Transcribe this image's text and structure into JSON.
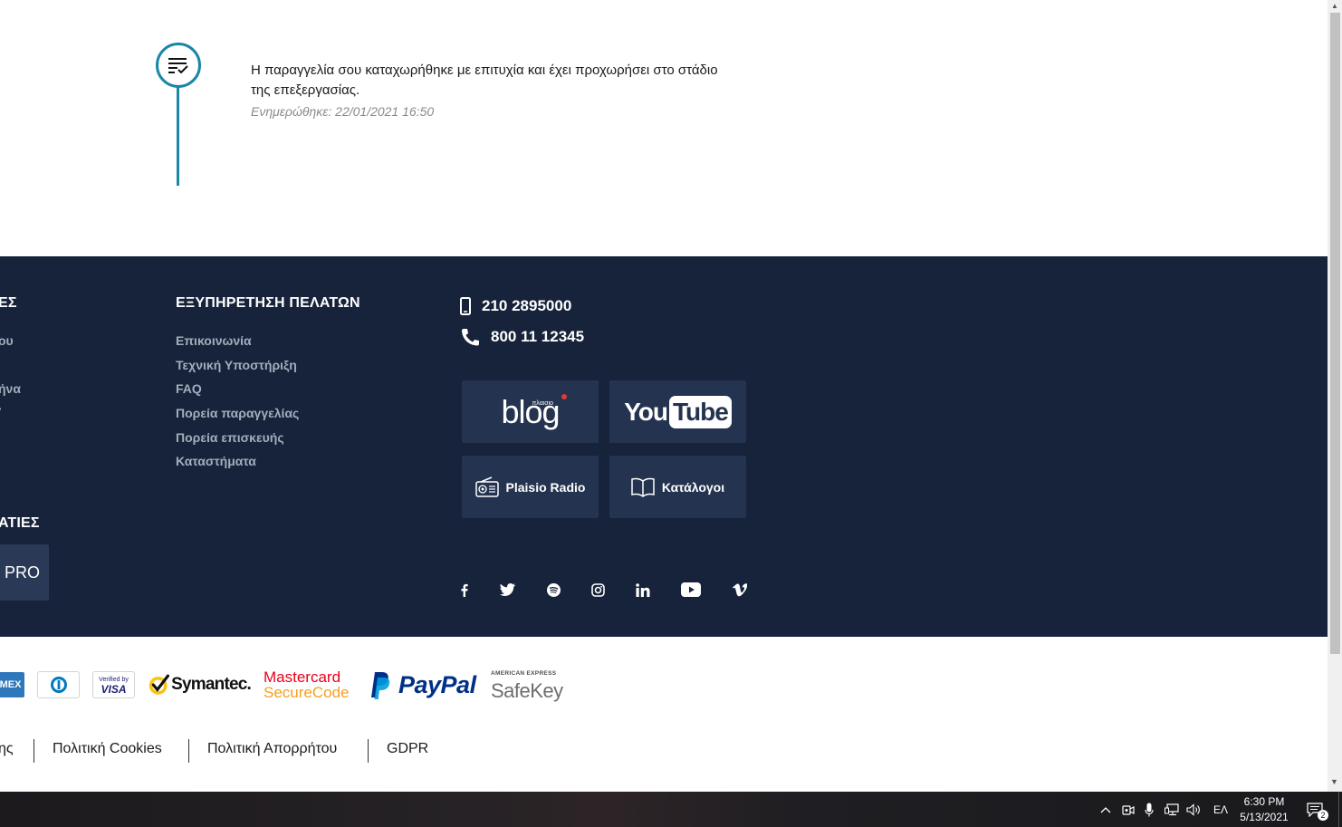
{
  "timeline": {
    "status_icon": "order-list-check-icon",
    "message": "Η παραγγελία σου καταχωρήθηκε με επιτυχία και έχει προχωρήσει στο στάδιο της επεξεργασίας.",
    "updated": "Ενημερώθηκε: 22/01/2021 16:50"
  },
  "footer": {
    "col1_head_partial": "ΕΣ",
    "col1_links_partial": [
      "ου",
      "ήνα",
      "·"
    ],
    "partnerships_head_partial": "ΑΤΙΕΣ",
    "pro_button": "PRO",
    "customer_service": {
      "heading": "ΕΞΥΠΗΡΕΤΗΣΗ ΠΕΛΑΤΩΝ",
      "links": [
        "Επικοινωνία",
        "Τεχνική Υποστήριξη",
        "FAQ",
        "Πορεία παραγγελίας",
        "Πορεία επισκευής",
        "Καταστήματα"
      ]
    },
    "phones": {
      "mobile": "210 2895000",
      "landline": "800 11 12345"
    },
    "tiles": {
      "blog_small": "πλαισιο",
      "blog": "blog",
      "youtube_you": "You",
      "youtube_tube": "Tube",
      "radio": "Plaisio Radio",
      "catalogs": "Κατάλογοι"
    },
    "social_icons": [
      "facebook-icon",
      "twitter-icon",
      "spotify-icon",
      "instagram-icon",
      "linkedin-icon",
      "youtube-icon",
      "vimeo-icon"
    ]
  },
  "payments": {
    "amex_partial": "MEX",
    "verified_line1": "Verified by",
    "verified_line2": "VISA",
    "symantec": "Symantec.",
    "mastercard_line1": "Mastercard",
    "mastercard_line2": "SecureCode",
    "paypal": "PayPal",
    "safekey_line1": "AMERICAN EXPRESS",
    "safekey_line2": "SafeKey"
  },
  "legal_links": {
    "partial": "ης",
    "cookies": "Πολιτική Cookies",
    "privacy": "Πολιτική Απορρήτου",
    "gdpr": "GDPR"
  },
  "taskbar": {
    "language": "ΕΛ",
    "time": "6:30 PM",
    "date": "5/13/2021",
    "notification_count": "2"
  },
  "colors": {
    "footer_bg": "#16233b",
    "tile_bg": "#24334f",
    "accent": "#1a86a8",
    "paypal_dark": "#003087",
    "paypal_light": "#009cde",
    "mastercard": "#eb001b"
  }
}
